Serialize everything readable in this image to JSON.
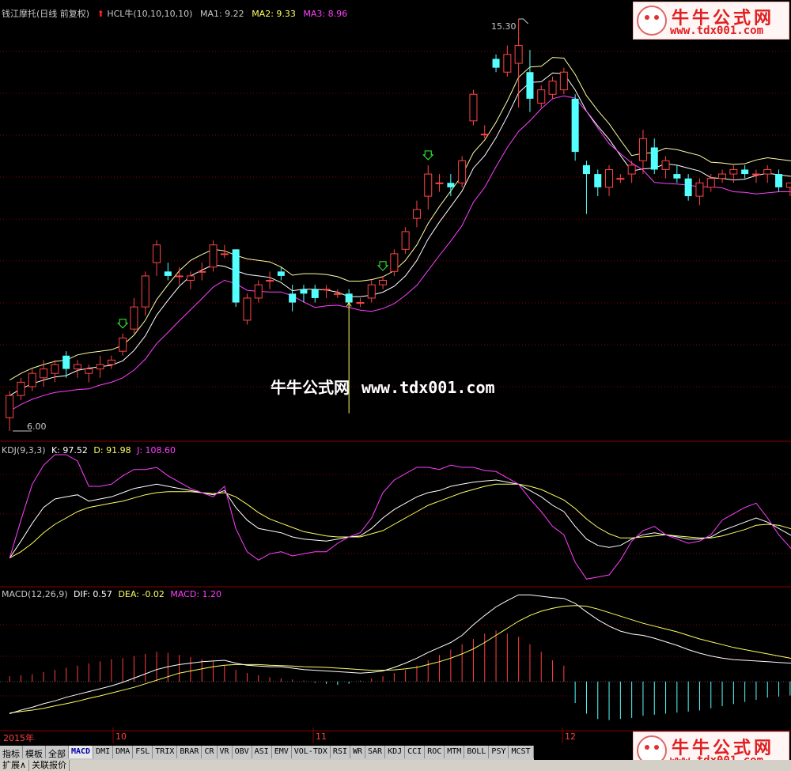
{
  "header": {
    "stock_name": "钱江摩托(日线 前复权)",
    "indicator_label": "HCL牛(10,10,10,10)",
    "ma1_label": "MA1: 9.22",
    "ma2_label": "MA2: 9.33",
    "ma3_label": "MA3: 8.96"
  },
  "kdj_header": {
    "name": "KDJ(9,3,3)",
    "k": "K: 97.52",
    "d": "D: 91.98",
    "j": "J: 108.60"
  },
  "macd_header": {
    "name": "MACD(12,26,9)",
    "dif": "DIF: 0.57",
    "dea": "DEA: -0.02",
    "macd": "MACD: 1.20"
  },
  "annotations": {
    "high": "15.30",
    "low": "6.00"
  },
  "watermark": {
    "title": "牛牛公式网",
    "url": "www.tdx001.com",
    "center": "牛牛公式网",
    "center_url": "www.tdx001.com"
  },
  "x_axis": [
    "2015年",
    "10",
    "11",
    "12"
  ],
  "tabs": [
    "指标",
    "模板",
    "全部",
    "MACD",
    "DMI",
    "DMA",
    "FSL",
    "TRIX",
    "BRAR",
    "CR",
    "VR",
    "OBV",
    "ASI",
    "EMV",
    "VOL-TDX",
    "RSI",
    "WR",
    "SAR",
    "KDJ",
    "CCI",
    "ROC",
    "MTM",
    "BOLL",
    "PSY",
    "MCST"
  ],
  "active_tab": "MACD",
  "bottom_bar": [
    "扩展∧",
    "关联报价"
  ],
  "colors": {
    "up": "#ff4444",
    "down": "#54ffff",
    "ma1": "#ffffa0",
    "ma2": "#ffffff",
    "ma3": "#ff40ff",
    "grid": "#8b0000"
  },
  "chart_data": {
    "type": "candlestick",
    "price_range": [
      6.0,
      15.3
    ],
    "candles": [
      [
        6.3,
        6.9,
        6.0,
        6.8
      ],
      [
        6.8,
        7.2,
        6.7,
        7.1
      ],
      [
        7.0,
        7.4,
        6.9,
        7.3
      ],
      [
        7.2,
        7.6,
        7.0,
        7.4
      ],
      [
        7.3,
        7.6,
        7.1,
        7.5
      ],
      [
        7.7,
        7.8,
        7.2,
        7.4
      ],
      [
        7.4,
        7.6,
        7.2,
        7.5
      ],
      [
        7.3,
        7.5,
        7.1,
        7.4
      ],
      [
        7.4,
        7.7,
        7.2,
        7.5
      ],
      [
        7.5,
        7.7,
        7.4,
        7.6
      ],
      [
        7.8,
        8.2,
        7.7,
        8.1
      ],
      [
        8.3,
        9.0,
        8.2,
        8.8
      ],
      [
        8.8,
        9.6,
        8.6,
        9.5
      ],
      [
        9.8,
        10.3,
        9.5,
        10.2
      ],
      [
        9.6,
        9.8,
        9.4,
        9.5
      ],
      [
        9.5,
        9.7,
        9.3,
        9.5
      ],
      [
        9.4,
        9.6,
        9.2,
        9.5
      ],
      [
        9.6,
        9.8,
        9.4,
        9.6
      ],
      [
        9.7,
        10.3,
        9.6,
        10.2
      ],
      [
        10.0,
        10.2,
        9.9,
        10.0
      ],
      [
        10.1,
        10.1,
        8.8,
        8.9
      ],
      [
        8.5,
        9.1,
        8.4,
        9.0
      ],
      [
        9.0,
        9.4,
        8.9,
        9.3
      ],
      [
        9.4,
        9.6,
        9.2,
        9.4
      ],
      [
        9.6,
        9.7,
        9.4,
        9.5
      ],
      [
        9.1,
        9.3,
        8.7,
        8.9
      ],
      [
        9.2,
        9.3,
        8.9,
        9.1
      ],
      [
        9.2,
        9.3,
        8.9,
        9.0
      ],
      [
        9.2,
        9.3,
        9.0,
        9.2
      ],
      [
        9.1,
        9.2,
        9.0,
        9.1
      ],
      [
        9.1,
        9.2,
        8.8,
        8.9
      ],
      [
        8.9,
        9.0,
        8.8,
        8.9
      ],
      [
        9.0,
        9.4,
        8.9,
        9.3
      ],
      [
        9.3,
        9.5,
        9.2,
        9.4
      ],
      [
        9.6,
        10.1,
        9.5,
        10.0
      ],
      [
        10.1,
        10.6,
        10.0,
        10.5
      ],
      [
        10.8,
        11.2,
        10.6,
        11.0
      ],
      [
        11.3,
        12.0,
        11.0,
        11.8
      ],
      [
        11.6,
        11.8,
        11.4,
        11.6
      ],
      [
        11.6,
        11.8,
        11.3,
        11.5
      ],
      [
        11.6,
        12.2,
        11.5,
        12.1
      ],
      [
        13.0,
        13.7,
        12.9,
        13.6
      ],
      [
        12.7,
        12.9,
        12.6,
        12.7
      ],
      [
        14.4,
        14.5,
        14.1,
        14.2
      ],
      [
        14.1,
        14.7,
        14.0,
        14.5
      ],
      [
        14.3,
        15.3,
        13.3,
        14.7
      ],
      [
        14.1,
        14.6,
        13.2,
        13.5
      ],
      [
        13.4,
        13.8,
        13.3,
        13.7
      ],
      [
        13.6,
        14.0,
        13.5,
        13.9
      ],
      [
        13.7,
        14.2,
        13.6,
        14.1
      ],
      [
        13.5,
        13.6,
        12.1,
        12.3
      ],
      [
        12.0,
        12.1,
        10.9,
        11.8
      ],
      [
        11.8,
        11.9,
        11.3,
        11.5
      ],
      [
        11.5,
        12.0,
        11.3,
        11.9
      ],
      [
        11.7,
        11.8,
        11.6,
        11.7
      ],
      [
        11.8,
        12.1,
        11.6,
        12.0
      ],
      [
        12.1,
        12.8,
        11.8,
        12.6
      ],
      [
        12.4,
        12.6,
        11.8,
        11.9
      ],
      [
        11.9,
        12.2,
        11.7,
        12.1
      ],
      [
        11.8,
        12.0,
        11.6,
        11.7
      ],
      [
        11.7,
        11.8,
        11.2,
        11.3
      ],
      [
        11.3,
        11.7,
        11.1,
        11.6
      ],
      [
        11.5,
        11.8,
        11.4,
        11.7
      ],
      [
        11.7,
        11.9,
        11.6,
        11.8
      ],
      [
        11.8,
        12.0,
        11.6,
        11.9
      ],
      [
        11.9,
        12.0,
        11.7,
        11.8
      ],
      [
        11.8,
        11.9,
        11.6,
        11.8
      ],
      [
        11.8,
        12.0,
        11.6,
        11.9
      ],
      [
        11.8,
        11.9,
        11.4,
        11.5
      ],
      [
        11.5,
        11.6,
        11.3,
        11.6
      ],
      [
        11.6,
        12.0,
        11.5,
        11.9
      ]
    ],
    "kdj": {
      "k": [
        12,
        28,
        45,
        60,
        68,
        70,
        72,
        66,
        68,
        70,
        74,
        78,
        80,
        82,
        80,
        78,
        76,
        74,
        72,
        76,
        60,
        48,
        40,
        38,
        36,
        32,
        30,
        29,
        28,
        30,
        32,
        33,
        40,
        50,
        58,
        64,
        70,
        74,
        76,
        80,
        82,
        84,
        85,
        86,
        84,
        82,
        76,
        70,
        62,
        56,
        42,
        30,
        24,
        22,
        24,
        30,
        34,
        36,
        34,
        32,
        30,
        30,
        32,
        38,
        42,
        46,
        50,
        46,
        40,
        34,
        28
      ],
      "d": [
        12,
        18,
        26,
        36,
        44,
        50,
        56,
        60,
        62,
        64,
        66,
        69,
        72,
        74,
        75,
        75,
        75,
        74,
        73,
        74,
        70,
        63,
        55,
        49,
        45,
        41,
        37,
        35,
        33,
        32,
        32,
        32,
        35,
        38,
        44,
        50,
        56,
        62,
        66,
        70,
        74,
        77,
        80,
        82,
        82,
        82,
        80,
        77,
        72,
        67,
        59,
        49,
        41,
        35,
        31,
        31,
        32,
        33,
        34,
        33,
        32,
        31,
        31,
        33,
        36,
        39,
        43,
        44,
        43,
        40,
        36
      ],
      "j": [
        12,
        48,
        82,
        100,
        110,
        110,
        104,
        80,
        80,
        82,
        90,
        96,
        96,
        98,
        90,
        84,
        78,
        74,
        70,
        80,
        40,
        18,
        10,
        16,
        18,
        14,
        16,
        18,
        18,
        26,
        32,
        36,
        50,
        74,
        86,
        92,
        98,
        98,
        96,
        100,
        98,
        98,
        95,
        94,
        88,
        82,
        68,
        56,
        42,
        34,
        8,
        -8,
        -6,
        -4,
        10,
        28,
        38,
        42,
        34,
        30,
        26,
        28,
        34,
        48,
        54,
        60,
        64,
        50,
        34,
        22,
        12
      ]
    },
    "macd": {
      "dif": [
        -0.9,
        -0.8,
        -0.72,
        -0.62,
        -0.54,
        -0.44,
        -0.36,
        -0.28,
        -0.2,
        -0.12,
        -0.02,
        0.1,
        0.22,
        0.34,
        0.42,
        0.48,
        0.52,
        0.56,
        0.58,
        0.6,
        0.52,
        0.46,
        0.44,
        0.42,
        0.42,
        0.38,
        0.34,
        0.32,
        0.3,
        0.28,
        0.26,
        0.24,
        0.26,
        0.3,
        0.4,
        0.52,
        0.66,
        0.82,
        0.96,
        1.1,
        1.3,
        1.6,
        1.86,
        2.1,
        2.28,
        2.44,
        2.44,
        2.4,
        2.36,
        2.34,
        2.2,
        1.96,
        1.74,
        1.56,
        1.42,
        1.34,
        1.3,
        1.22,
        1.12,
        1.02,
        0.9,
        0.8,
        0.72,
        0.66,
        0.62,
        0.6,
        0.58,
        0.56,
        0.54,
        0.52,
        0.5
      ],
      "dea": [
        -0.88,
        -0.84,
        -0.8,
        -0.75,
        -0.68,
        -0.62,
        -0.55,
        -0.47,
        -0.4,
        -0.32,
        -0.24,
        -0.16,
        -0.06,
        0.04,
        0.14,
        0.24,
        0.3,
        0.36,
        0.42,
        0.46,
        0.48,
        0.48,
        0.48,
        0.46,
        0.45,
        0.44,
        0.42,
        0.41,
        0.4,
        0.38,
        0.36,
        0.34,
        0.32,
        0.32,
        0.33,
        0.36,
        0.4,
        0.48,
        0.56,
        0.66,
        0.78,
        0.92,
        1.1,
        1.3,
        1.5,
        1.7,
        1.86,
        1.98,
        2.06,
        2.12,
        2.14,
        2.12,
        2.04,
        1.94,
        1.84,
        1.74,
        1.64,
        1.56,
        1.48,
        1.4,
        1.3,
        1.2,
        1.12,
        1.04,
        0.96,
        0.9,
        0.84,
        0.78,
        0.72,
        0.66,
        0.6
      ],
      "hist": [
        0.1,
        0.12,
        0.14,
        0.18,
        0.22,
        0.26,
        0.3,
        0.34,
        0.38,
        0.42,
        0.44,
        0.48,
        0.52,
        0.56,
        0.54,
        0.5,
        0.46,
        0.42,
        0.38,
        0.3,
        0.22,
        0.16,
        0.12,
        0.08,
        0.06,
        0.04,
        0.02,
        -0.02,
        -0.04,
        -0.06,
        -0.04,
        0.02,
        0.06,
        0.1,
        0.16,
        0.22,
        0.3,
        0.4,
        0.5,
        0.6,
        0.7,
        0.8,
        0.9,
        0.96,
        0.9,
        0.84,
        0.7,
        0.56,
        0.4,
        0.3,
        -0.4,
        -0.6,
        -0.7,
        -0.72,
        -0.7,
        -0.68,
        -0.64,
        -0.62,
        -0.6,
        -0.58,
        -0.56,
        -0.54,
        -0.5,
        -0.46,
        -0.42,
        -0.38,
        -0.34,
        -0.3,
        -0.28,
        -0.26,
        -0.24
      ]
    }
  }
}
